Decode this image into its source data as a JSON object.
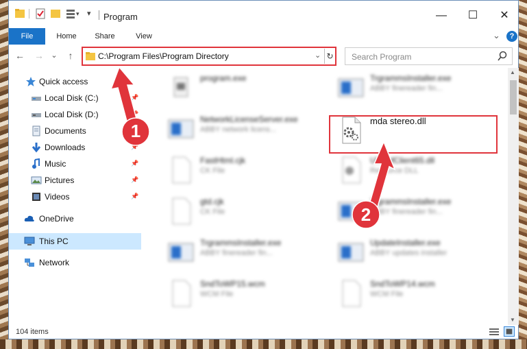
{
  "window": {
    "title": "Program",
    "controls": {
      "minimize": "—",
      "maximize": "☐",
      "close": "✕"
    }
  },
  "ribbon": {
    "tabs": [
      "File",
      "Home",
      "Share",
      "View"
    ],
    "collapse": "⌄",
    "help": "?"
  },
  "nav": {
    "back": "←",
    "forward": "→",
    "recent": "⌄",
    "up": "↑",
    "address": "C:\\Program Files\\Program Directory",
    "address_dropdown": "⌄",
    "refresh": "↻",
    "search_placeholder": "Search Program"
  },
  "sidebar": {
    "items": [
      {
        "label": "Quick access",
        "icon": "star-icon",
        "pinned": false
      },
      {
        "label": "Local Disk (C:)",
        "icon": "drive-icon",
        "pinned": true
      },
      {
        "label": "Local Disk (D:)",
        "icon": "drive-icon",
        "pinned": true
      },
      {
        "label": "Documents",
        "icon": "documents-icon",
        "pinned": true
      },
      {
        "label": "Downloads",
        "icon": "download-icon",
        "pinned": true
      },
      {
        "label": "Music",
        "icon": "music-icon",
        "pinned": true
      },
      {
        "label": "Pictures",
        "icon": "pictures-icon",
        "pinned": true
      },
      {
        "label": "Videos",
        "icon": "videos-icon",
        "pinned": true
      },
      {
        "label": "OneDrive",
        "icon": "cloud-icon",
        "pinned": false
      },
      {
        "label": "This PC",
        "icon": "pc-icon",
        "pinned": false,
        "selected": true
      },
      {
        "label": "Network",
        "icon": "network-icon",
        "pinned": false
      }
    ],
    "pin_glyph": "📌"
  },
  "files": [
    {
      "name": "program.exe",
      "sub": "",
      "icon": "exe-icon"
    },
    {
      "name": "TrgrammsInstaller.exe",
      "sub": "ABBY finereader fin...",
      "icon": "installer-icon"
    },
    {
      "name": "NetworkLicenseServer.exe",
      "sub": "ABBY network licens...",
      "icon": "installer-icon"
    },
    {
      "name": "mda stereo.dll",
      "sub": "",
      "icon": "dll-gear-icon",
      "focused": true
    },
    {
      "name": "FastHtml.cjk",
      "sub": "CK File",
      "icon": "generic-file-icon"
    },
    {
      "name": "UbLtsfClient65.dll",
      "sub": "Resource DLL",
      "icon": "dll-gear-icon"
    },
    {
      "name": "gtd.cjk",
      "sub": "CK File",
      "icon": "generic-file-icon"
    },
    {
      "name": "TrgrammsInstaller.exe",
      "sub": "ABBY finereader fin...",
      "icon": "installer-icon"
    },
    {
      "name": "TrgrammsInstaller.exe",
      "sub": "ABBY finereader fin...",
      "icon": "installer-icon"
    },
    {
      "name": "UpdateInstaller.exe",
      "sub": "ABBY updates installer",
      "icon": "installer-icon"
    },
    {
      "name": "SndToWP15.wcm",
      "sub": "WCM File",
      "icon": "generic-file-icon"
    },
    {
      "name": "SndToWP14.wcm",
      "sub": "WCM File",
      "icon": "generic-file-icon"
    }
  ],
  "callouts": {
    "one": "1",
    "two": "2"
  },
  "status": {
    "count": "104 items"
  },
  "colors": {
    "accent": "#1a73c8",
    "highlight": "#e0343b",
    "selected": "#cce8ff"
  }
}
